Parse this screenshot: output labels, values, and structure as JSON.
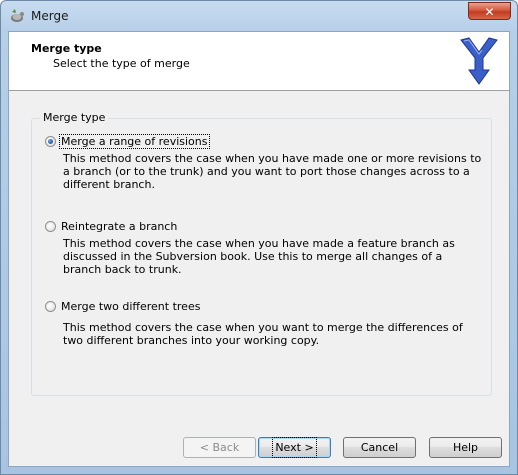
{
  "window": {
    "title": "Merge",
    "close_glyph": "✕"
  },
  "header": {
    "title": "Merge type",
    "subtitle": "Select the type of merge",
    "logo_icon": "tortoisesvn-merge-icon"
  },
  "group": {
    "legend": "Merge type",
    "options": [
      {
        "label": "Merge a range of revisions",
        "description": "This method covers the case when you have made one or more revisions to a branch (or to the trunk) and you want to port those changes across to a different branch.",
        "checked": true
      },
      {
        "label": "Reintegrate a branch",
        "description": "This method covers the case when you have made a feature branch as discussed in the Subversion book. Use this to merge all changes of a branch back to trunk.",
        "checked": false
      },
      {
        "label": "Merge two different trees",
        "description": "This method covers the case when you want to merge the differences of two different branches into your working copy.",
        "checked": false
      }
    ]
  },
  "buttons": {
    "back": "< Back",
    "next": "Next >",
    "cancel": "Cancel",
    "help": "Help"
  },
  "colors": {
    "accent": "#3c7fb1",
    "logo_blue": "#3a5fc8",
    "close_red": "#c23b1f"
  }
}
